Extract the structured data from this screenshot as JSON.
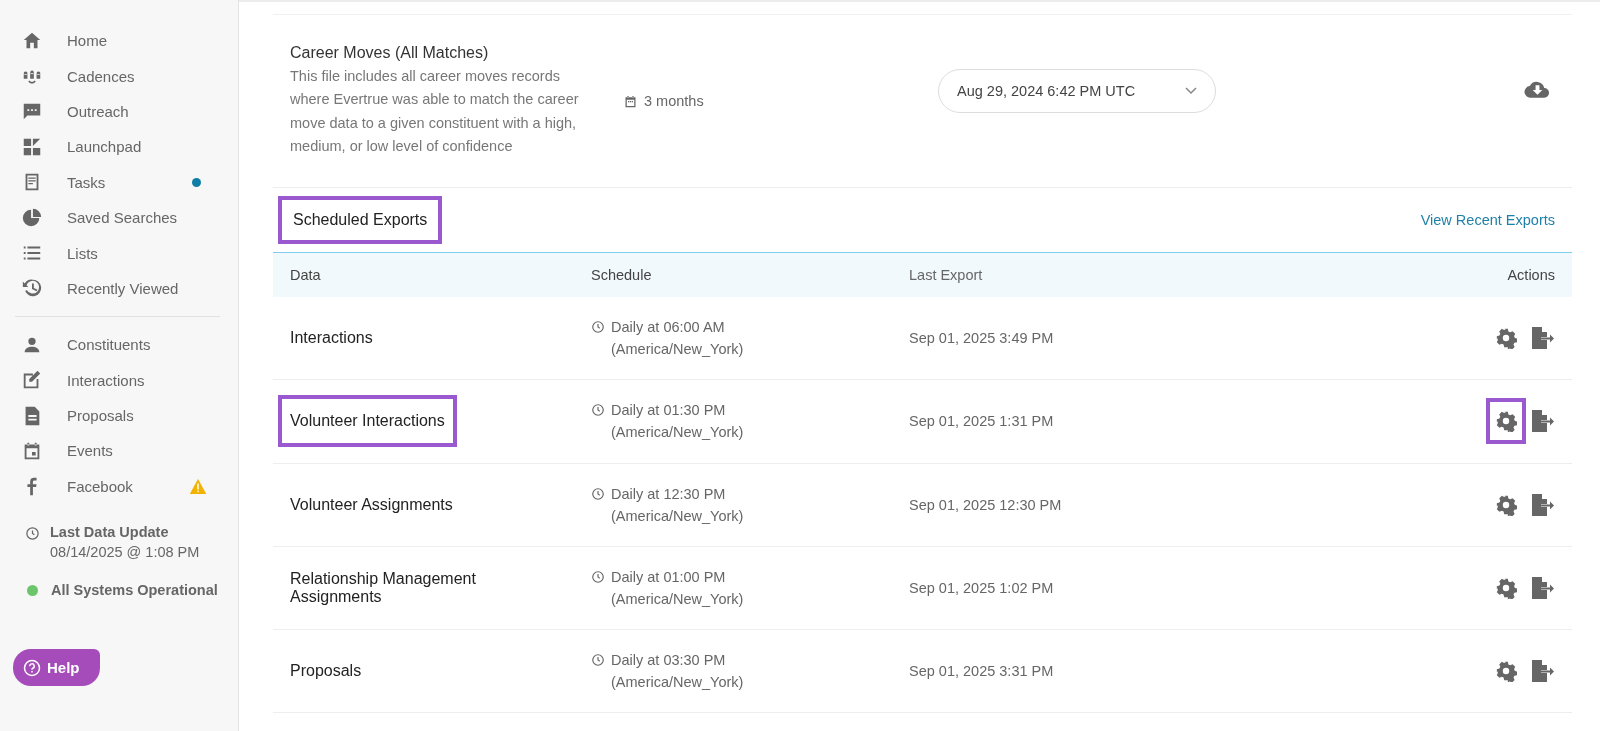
{
  "sidebar": {
    "groups": [
      [
        {
          "label": "Home",
          "kind": "plain"
        },
        {
          "label": "Cadences",
          "kind": "plain"
        },
        {
          "label": "Outreach",
          "kind": "plain"
        },
        {
          "label": "Launchpad",
          "kind": "plain"
        },
        {
          "label": "Tasks",
          "kind": "dot",
          "color": "#0f7ea6"
        },
        {
          "label": "Saved Searches",
          "kind": "plain"
        },
        {
          "label": "Lists",
          "kind": "plain"
        },
        {
          "label": "Recently Viewed",
          "kind": "plain"
        }
      ],
      [
        {
          "label": "Constituents",
          "kind": "plain"
        },
        {
          "label": "Interactions",
          "kind": "plain"
        },
        {
          "label": "Proposals",
          "kind": "plain"
        },
        {
          "label": "Events",
          "kind": "plain"
        },
        {
          "label": "Facebook",
          "kind": "warning"
        }
      ]
    ],
    "last_update": {
      "title": "Last Data Update",
      "value": "08/14/2025 @ 1:08 PM"
    },
    "system_status": {
      "label": "All Systems Operational",
      "color": "#6cc56a"
    },
    "help": "Help"
  },
  "file": {
    "title": "Career Moves (All Matches)",
    "description": "This file includes all career moves records where Evertrue was able to match the career move data to a given constituent with a high, medium, or low level of confidence",
    "period": "3 months",
    "version": "Aug 29, 2024 6:42 PM UTC"
  },
  "scheduled": {
    "title": "Scheduled Exports",
    "highlighted": true,
    "link": "View Recent Exports",
    "columns": [
      "Data",
      "Schedule",
      "Last Export",
      "Actions"
    ],
    "rows": [
      {
        "name": "Interactions",
        "schedule": "Daily at 06:00 AM",
        "zone": "(America/New_York)",
        "last": "Sep 01, 2025 3:49 PM",
        "name_highlighted": false,
        "settings_highlighted": false
      },
      {
        "name": "Volunteer Interactions",
        "schedule": "Daily at 01:30 PM",
        "zone": "(America/New_York)",
        "last": "Sep 01, 2025 1:31 PM",
        "name_highlighted": true,
        "settings_highlighted": true
      },
      {
        "name": "Volunteer Assignments",
        "schedule": "Daily at 12:30 PM",
        "zone": "(America/New_York)",
        "last": "Sep 01, 2025 12:30 PM",
        "name_highlighted": false,
        "settings_highlighted": false
      },
      {
        "name": "Relationship Management Assignments",
        "schedule": "Daily at 01:00 PM",
        "zone": "(America/New_York)",
        "last": "Sep 01, 2025 1:02 PM",
        "name_highlighted": false,
        "settings_highlighted": false
      },
      {
        "name": "Proposals",
        "schedule": "Daily at 03:30 PM",
        "zone": "(America/New_York)",
        "last": "Sep 01, 2025 3:31 PM",
        "name_highlighted": false,
        "settings_highlighted": false
      }
    ]
  }
}
